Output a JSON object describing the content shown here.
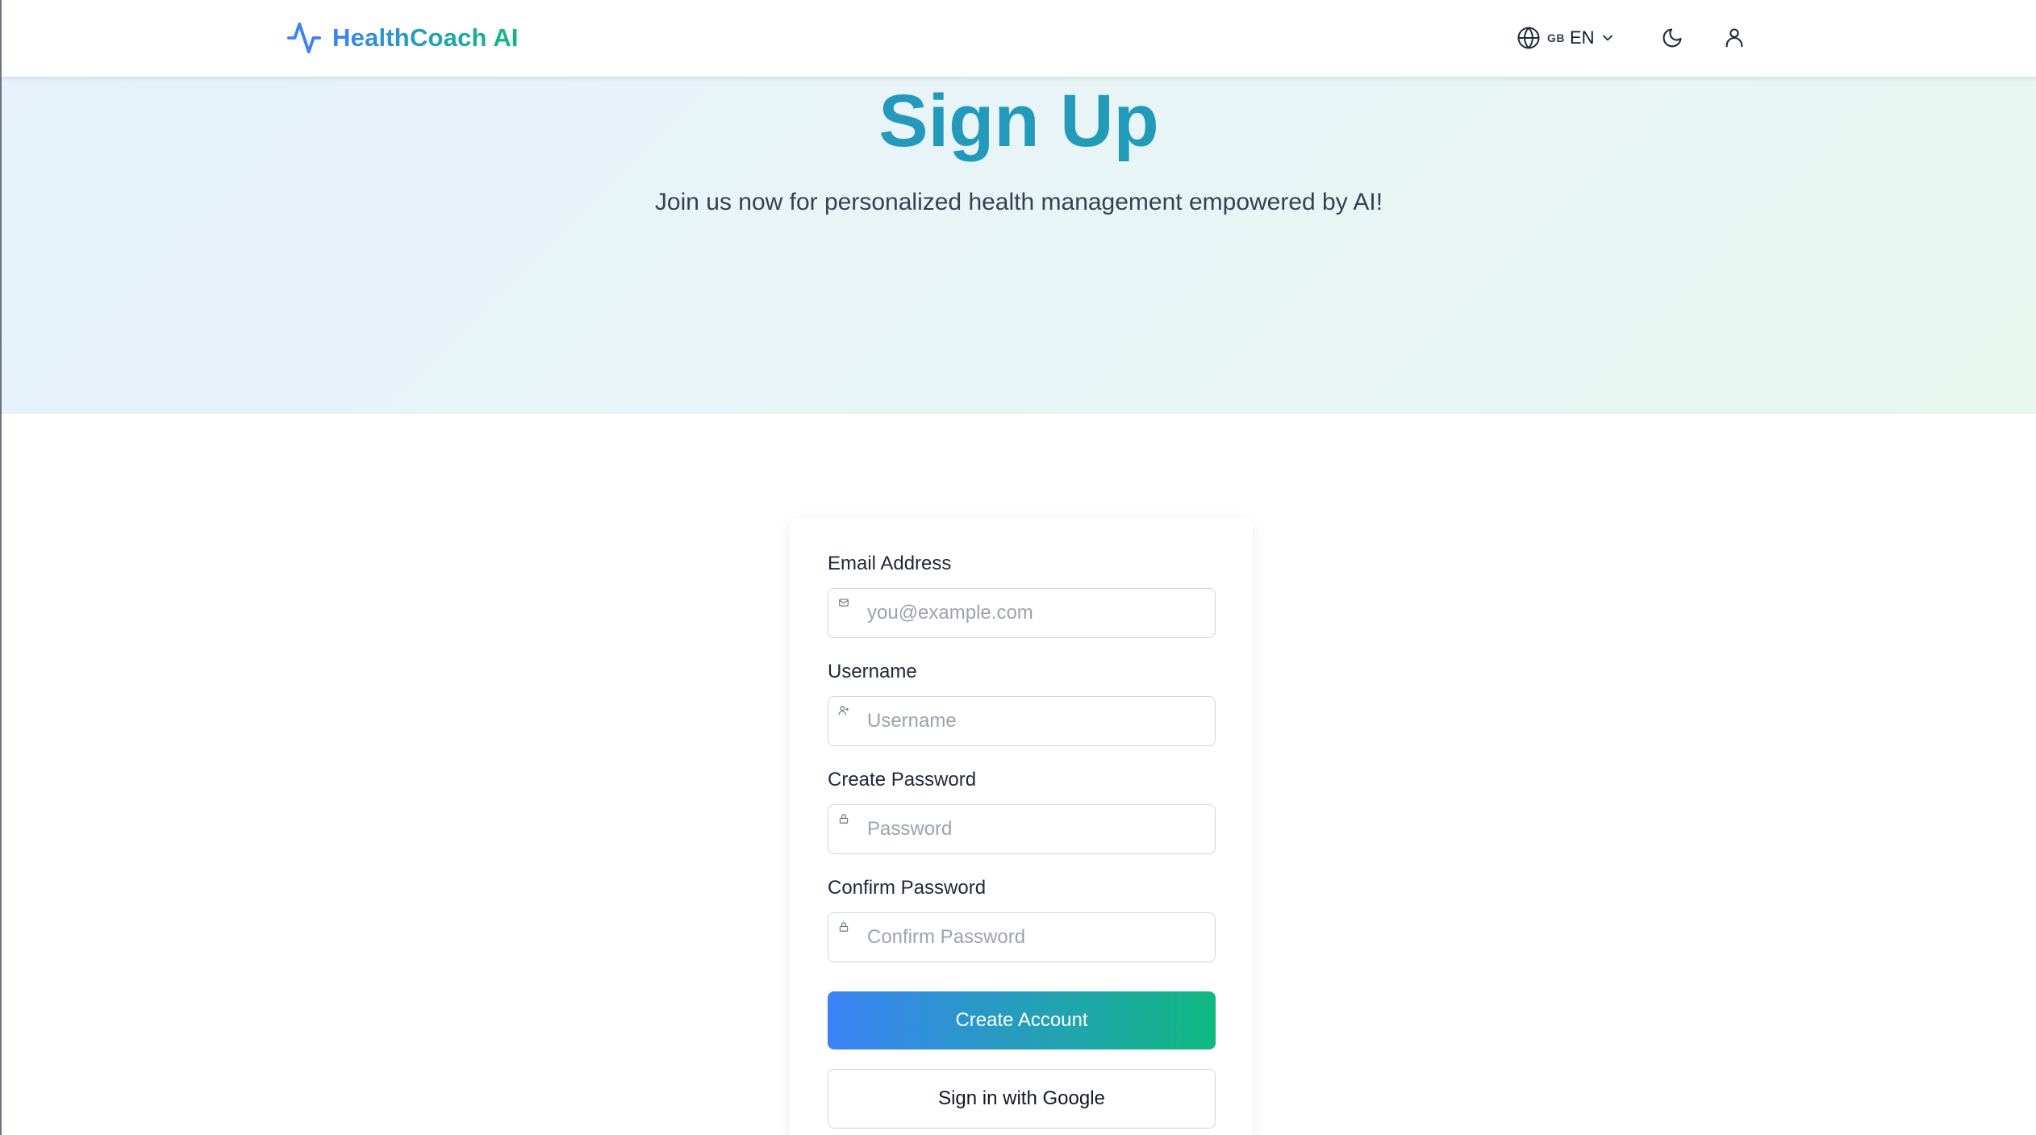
{
  "brand": {
    "name": "HealthCoach AI",
    "icon": "activity-pulse-icon"
  },
  "header": {
    "language": {
      "flag": "GB",
      "code": "EN",
      "icon": "globe-icon"
    },
    "theme_toggle_icon": "moon-icon",
    "account_icon": "user-icon"
  },
  "hero": {
    "title": "Sign Up",
    "subtitle": "Join us now for personalized health management empowered by AI!"
  },
  "form": {
    "email": {
      "label": "Email Address",
      "placeholder": "you@example.com",
      "value": "",
      "icon": "mail-icon"
    },
    "username": {
      "label": "Username",
      "placeholder": "Username",
      "value": "",
      "icon": "user-add-icon"
    },
    "password": {
      "label": "Create Password",
      "placeholder": "Password",
      "value": "",
      "icon": "lock-icon"
    },
    "confirm_password": {
      "label": "Confirm Password",
      "placeholder": "Confirm Password",
      "value": "",
      "icon": "lock-icon"
    },
    "submit_label": "Create Account",
    "google_label": "Sign in with Google"
  },
  "colors": {
    "brand_blue": "#3b82f6",
    "brand_green": "#10b981",
    "title_gradient_start": "#2b8fd1",
    "title_gradient_end": "#1aa5a4"
  }
}
